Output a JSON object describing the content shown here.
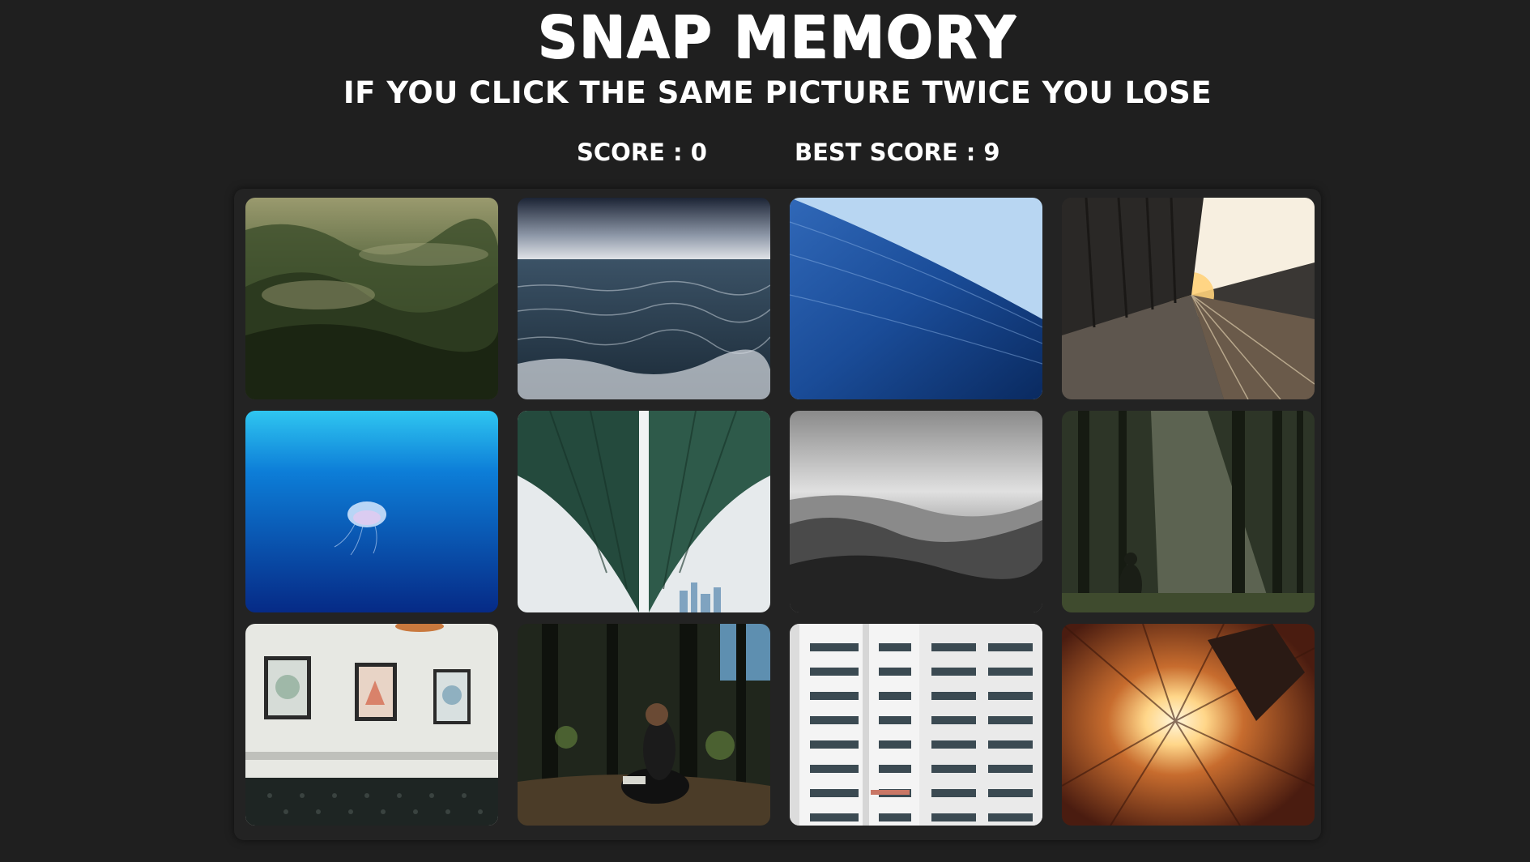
{
  "header": {
    "title": "SNAP MEMORY",
    "subtitle": "IF YOU CLICK THE SAME PICTURE TWICE YOU LOSE"
  },
  "scores": {
    "score_text": "SCORE : 0",
    "best_text": "BEST SCORE : 9",
    "score": 0,
    "best": 9
  },
  "cards": [
    {
      "scene": "misty-forest-hills"
    },
    {
      "scene": "stormy-sea"
    },
    {
      "scene": "blue-wave"
    },
    {
      "scene": "train-platform-sunset"
    },
    {
      "scene": "jellyfish-underwater"
    },
    {
      "scene": "green-bridge-underside"
    },
    {
      "scene": "monochrome-valley"
    },
    {
      "scene": "forest-sunrays-figure"
    },
    {
      "scene": "gallery-wall-sofa"
    },
    {
      "scene": "woman-reading-in-woods"
    },
    {
      "scene": "white-apartment-building"
    },
    {
      "scene": "courtyard-looking-up-sun"
    }
  ]
}
